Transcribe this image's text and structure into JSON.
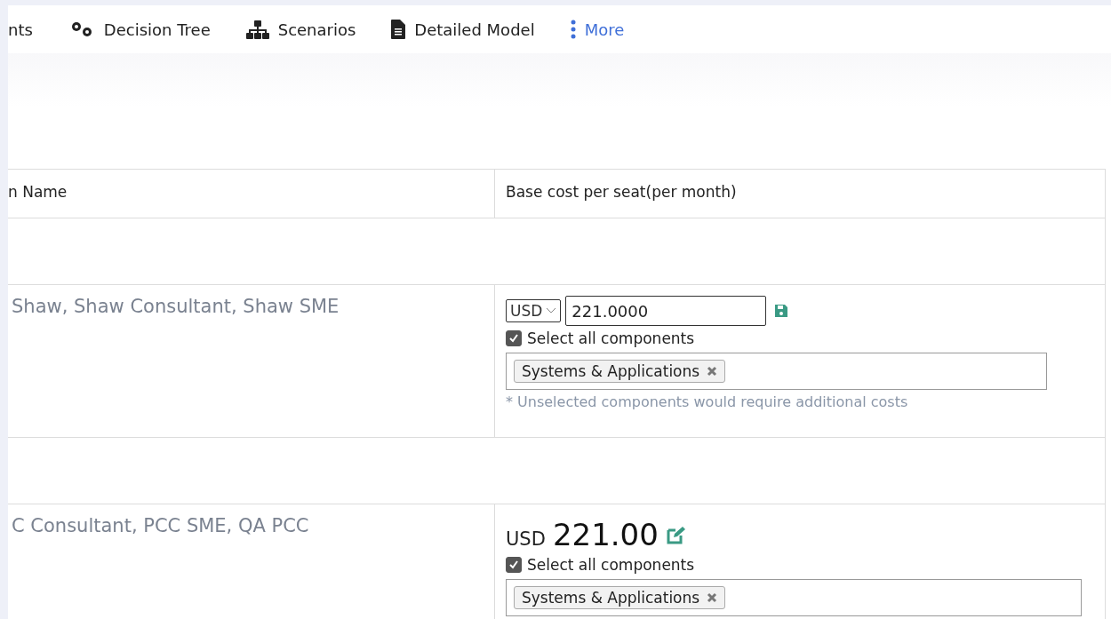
{
  "nav": [
    {
      "label": "nts",
      "kind": "plain"
    },
    {
      "label": "Decision Tree",
      "kind": "plain"
    },
    {
      "label": "Scenarios",
      "kind": "plain"
    },
    {
      "label": "Detailed Model",
      "kind": "plain"
    },
    {
      "label": "More",
      "kind": "link"
    }
  ],
  "table": {
    "columns": [
      "n Name",
      "Base cost per seat(per month)"
    ],
    "rows": [
      {
        "kind": "spacer"
      },
      {
        "kind": "edit",
        "name": "Shaw, Shaw Consultant, Shaw SME",
        "currency": "USD",
        "value": "221.0000",
        "select_all": {
          "label": "Select all components",
          "checked": true
        },
        "tags": [
          "Systems & Applications"
        ],
        "note": "* Unselected components would require additional costs"
      },
      {
        "kind": "spacer"
      },
      {
        "kind": "view",
        "name": "C Consultant, PCC SME, QA PCC",
        "currency": "USD",
        "value": "221.00",
        "select_all": {
          "label": "Select all components",
          "checked": true
        },
        "tags": [
          "Systems & Applications"
        ]
      }
    ]
  }
}
